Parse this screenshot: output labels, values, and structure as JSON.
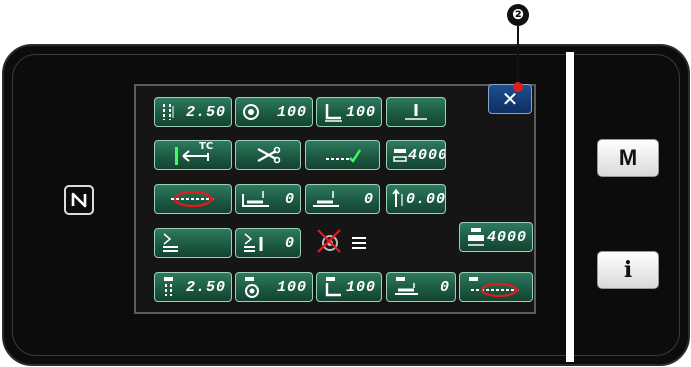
{
  "callout": {
    "number": "❷"
  },
  "side_buttons": {
    "mode_label": "M",
    "info_label": "i"
  },
  "screen": {
    "close_label": "✕",
    "rows": [
      [
        {
          "id": "pitch",
          "icon": "stitch-pitch-icon",
          "value": "2.50"
        },
        {
          "id": "tension",
          "icon": "thread-tension-icon",
          "value": "100"
        },
        {
          "id": "presser-pressure",
          "icon": "presser-foot-icon",
          "value": "100"
        },
        {
          "id": "needle-position",
          "icon": "needle-position-icon",
          "value": ""
        }
      ],
      [
        {
          "id": "thread-clamp",
          "icon": "thread-clamp-tc-icon",
          "value": "",
          "icon_text": "TC"
        },
        {
          "id": "thread-trim",
          "icon": "scissors-icon",
          "value": ""
        },
        {
          "id": "stitch-check",
          "icon": "stitch-check-icon",
          "value": ""
        },
        {
          "id": "max-speed",
          "icon": "speed-icon",
          "value": "4000"
        }
      ],
      [
        {
          "id": "reverse-feed",
          "icon": "reverse-feed-icon",
          "value": ""
        },
        {
          "id": "feed-adj-1",
          "icon": "feed-adjust-icon",
          "value": "0"
        },
        {
          "id": "feed-adj-2",
          "icon": "feed-adjust-2-icon",
          "value": "0"
        },
        {
          "id": "height-adj",
          "icon": "height-adjust-icon",
          "value": "0.00"
        }
      ],
      [
        {
          "id": "condensed-1",
          "icon": "condensed-stitch-icon",
          "value": ""
        },
        {
          "id": "condensed-2",
          "icon": "condensed-stitch-needle-icon",
          "value": "0"
        },
        {
          "id": "tension-off",
          "icon": "tension-disabled-icon",
          "value": ""
        },
        {
          "id": "motor-speed",
          "icon": "motor-speed-icon",
          "value": "4000"
        }
      ],
      [
        {
          "id": "sub-pitch",
          "icon": "sub-pitch-icon",
          "value": "2.50"
        },
        {
          "id": "sub-tension",
          "icon": "sub-tension-icon",
          "value": "100"
        },
        {
          "id": "sub-presser",
          "icon": "sub-presser-icon",
          "value": "100"
        },
        {
          "id": "sub-feed",
          "icon": "sub-feed-icon",
          "value": "0"
        },
        {
          "id": "sub-reverse",
          "icon": "sub-reverse-icon",
          "value": ""
        }
      ]
    ]
  }
}
